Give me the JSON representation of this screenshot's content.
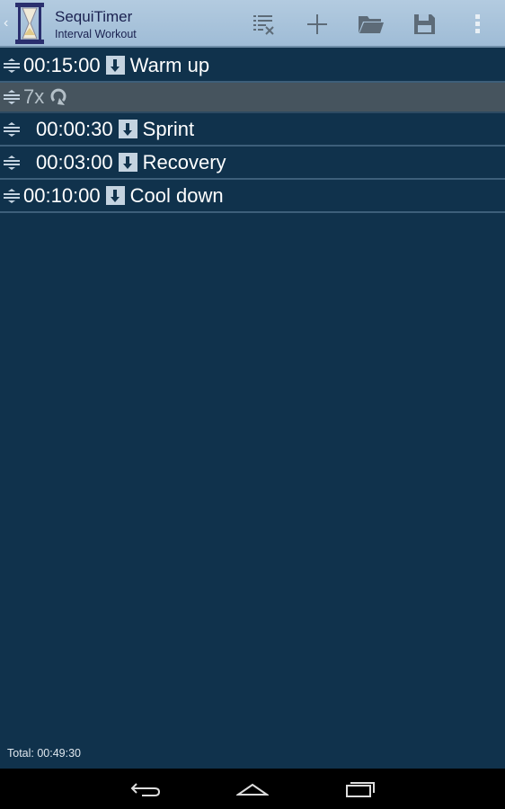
{
  "header": {
    "title": "SequiTimer",
    "subtitle": "Interval Workout",
    "actions": [
      {
        "name": "clear-list-icon"
      },
      {
        "name": "add-icon"
      },
      {
        "name": "open-folder-icon"
      },
      {
        "name": "save-icon"
      },
      {
        "name": "overflow-menu-icon"
      }
    ]
  },
  "list": [
    {
      "type": "step",
      "time": "00:15:00",
      "label": "Warm up",
      "indent": false
    },
    {
      "type": "repeat",
      "label": "7x",
      "icon": "repeat-icon"
    },
    {
      "type": "step",
      "time": "00:00:30",
      "label": "Sprint",
      "indent": true
    },
    {
      "type": "step",
      "time": "00:03:00",
      "label": "Recovery",
      "indent": true
    },
    {
      "type": "step",
      "time": "00:10:00",
      "label": "Cool down",
      "indent": false
    }
  ],
  "footer": {
    "total": "Total: 00:49:30"
  },
  "nav": [
    "back-icon",
    "home-icon",
    "recent-apps-icon"
  ]
}
